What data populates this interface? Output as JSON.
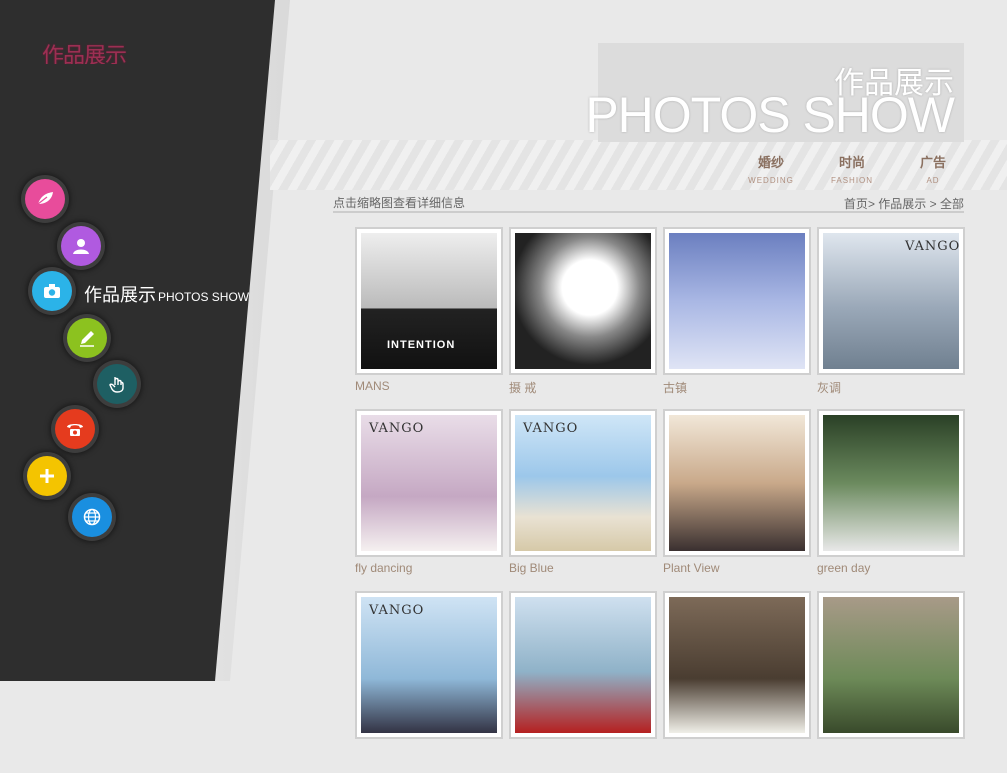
{
  "brand": {
    "logo_text": "作品展示"
  },
  "nav": {
    "active_label_cn": "作品展示",
    "active_label_en": "PHOTOS SHOW",
    "items": [
      {
        "icon": "leaf-icon",
        "color": "#e84c9b"
      },
      {
        "icon": "user-icon",
        "color": "#b05ae0"
      },
      {
        "icon": "camera-icon",
        "color": "#2bb3e8"
      },
      {
        "icon": "pencil-icon",
        "color": "#8cc21f"
      },
      {
        "icon": "hand-pointer-icon",
        "color": "#1e5f63"
      },
      {
        "icon": "phone-icon",
        "color": "#e53b1e"
      },
      {
        "icon": "plus-icon",
        "color": "#f4c400"
      },
      {
        "icon": "globe-icon",
        "color": "#1a8fe0"
      }
    ]
  },
  "header": {
    "title_cn": "作品展示",
    "title_en": "PHOTOS SHOW",
    "categories": [
      {
        "cn": "婚纱",
        "en": "WEDDING"
      },
      {
        "cn": "时尚",
        "en": "FASHION"
      },
      {
        "cn": "广告",
        "en": "AD"
      }
    ]
  },
  "toolbar": {
    "hint": "点击缩略图查看详细信息",
    "breadcrumb": [
      "首页",
      "作品展示",
      "全部"
    ]
  },
  "gallery": {
    "items": [
      {
        "caption": "MANS",
        "brand": "",
        "tag": "INTENTION"
      },
      {
        "caption": "摄 戒",
        "brand": "",
        "tag": ""
      },
      {
        "caption": "古镇",
        "brand": "",
        "tag": ""
      },
      {
        "caption": "灰调",
        "brand": "VANGO",
        "tag": ""
      },
      {
        "caption": "fly dancing",
        "brand": "VANGO",
        "tag": ""
      },
      {
        "caption": "Big Blue",
        "brand": "VANGO",
        "tag": ""
      },
      {
        "caption": "Plant View",
        "brand": "",
        "tag": ""
      },
      {
        "caption": "green day",
        "brand": "",
        "tag": ""
      },
      {
        "caption": "",
        "brand": "VANGO",
        "tag": ""
      },
      {
        "caption": "",
        "brand": "",
        "tag": ""
      },
      {
        "caption": "",
        "brand": "",
        "tag": ""
      },
      {
        "caption": "",
        "brand": "",
        "tag": ""
      }
    ]
  }
}
